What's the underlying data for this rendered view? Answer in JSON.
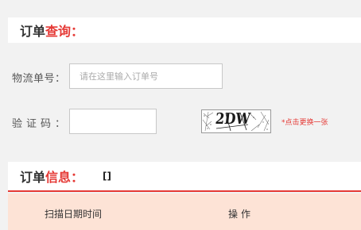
{
  "query_section": {
    "title_black": "订单",
    "title_red": "查询："
  },
  "form": {
    "order_label": "物流单号：",
    "order_placeholder": "请在这里输入订单号",
    "order_value": "",
    "captcha_label": "验证码：",
    "captcha_value": "",
    "captcha_text": "2DW",
    "refresh_text": "*点击更换一张"
  },
  "info_section": {
    "title_black": "订单",
    "title_red": "信息：",
    "bracket": "[]"
  },
  "table": {
    "columns": [
      "扫描日期时间",
      "操作"
    ]
  },
  "colors": {
    "accent": "#e53935",
    "background": "#f2f2f2",
    "table_header_bg": "#fde3d6"
  }
}
